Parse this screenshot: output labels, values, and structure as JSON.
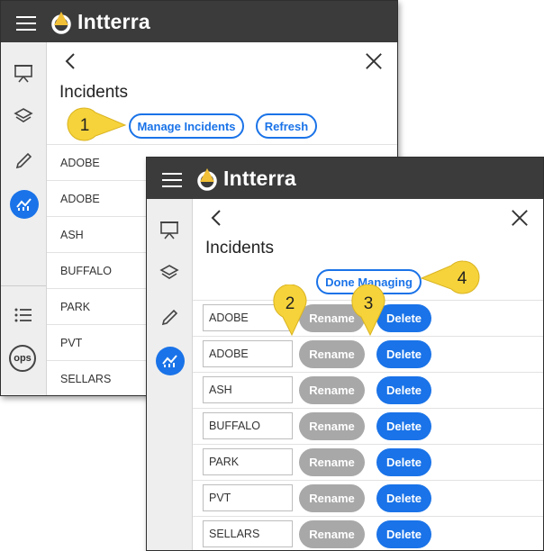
{
  "app": {
    "logo_text": "Intterra"
  },
  "back_panel": {
    "title": "Incidents",
    "manage_label": "Manage Incidents",
    "refresh_label": "Refresh",
    "items": [
      "ADOBE",
      "ADOBE",
      "ASH",
      "BUFFALO",
      "PARK",
      "PVT",
      "SELLARS"
    ],
    "ops_label": "ops"
  },
  "front_panel": {
    "title": "Incidents",
    "done_label": "Done Managing",
    "rename_label": "Rename",
    "delete_label": "Delete",
    "items": [
      "ADOBE",
      "ADOBE",
      "ASH",
      "BUFFALO",
      "PARK",
      "PVT",
      "SELLARS"
    ]
  },
  "callouts": [
    "1",
    "2",
    "3",
    "4"
  ],
  "colors": {
    "topbar": "#3b3b3b",
    "accent": "#1a73e8",
    "callout": "#f6d33b",
    "rename": "#a8a8a8",
    "logo": "#f2c037"
  },
  "icons": [
    "hamburger-icon",
    "intterra-logo-icon",
    "presentation-icon",
    "layers-icon",
    "pencil-icon",
    "analytics-icon",
    "list-icon",
    "back-icon",
    "close-icon"
  ]
}
